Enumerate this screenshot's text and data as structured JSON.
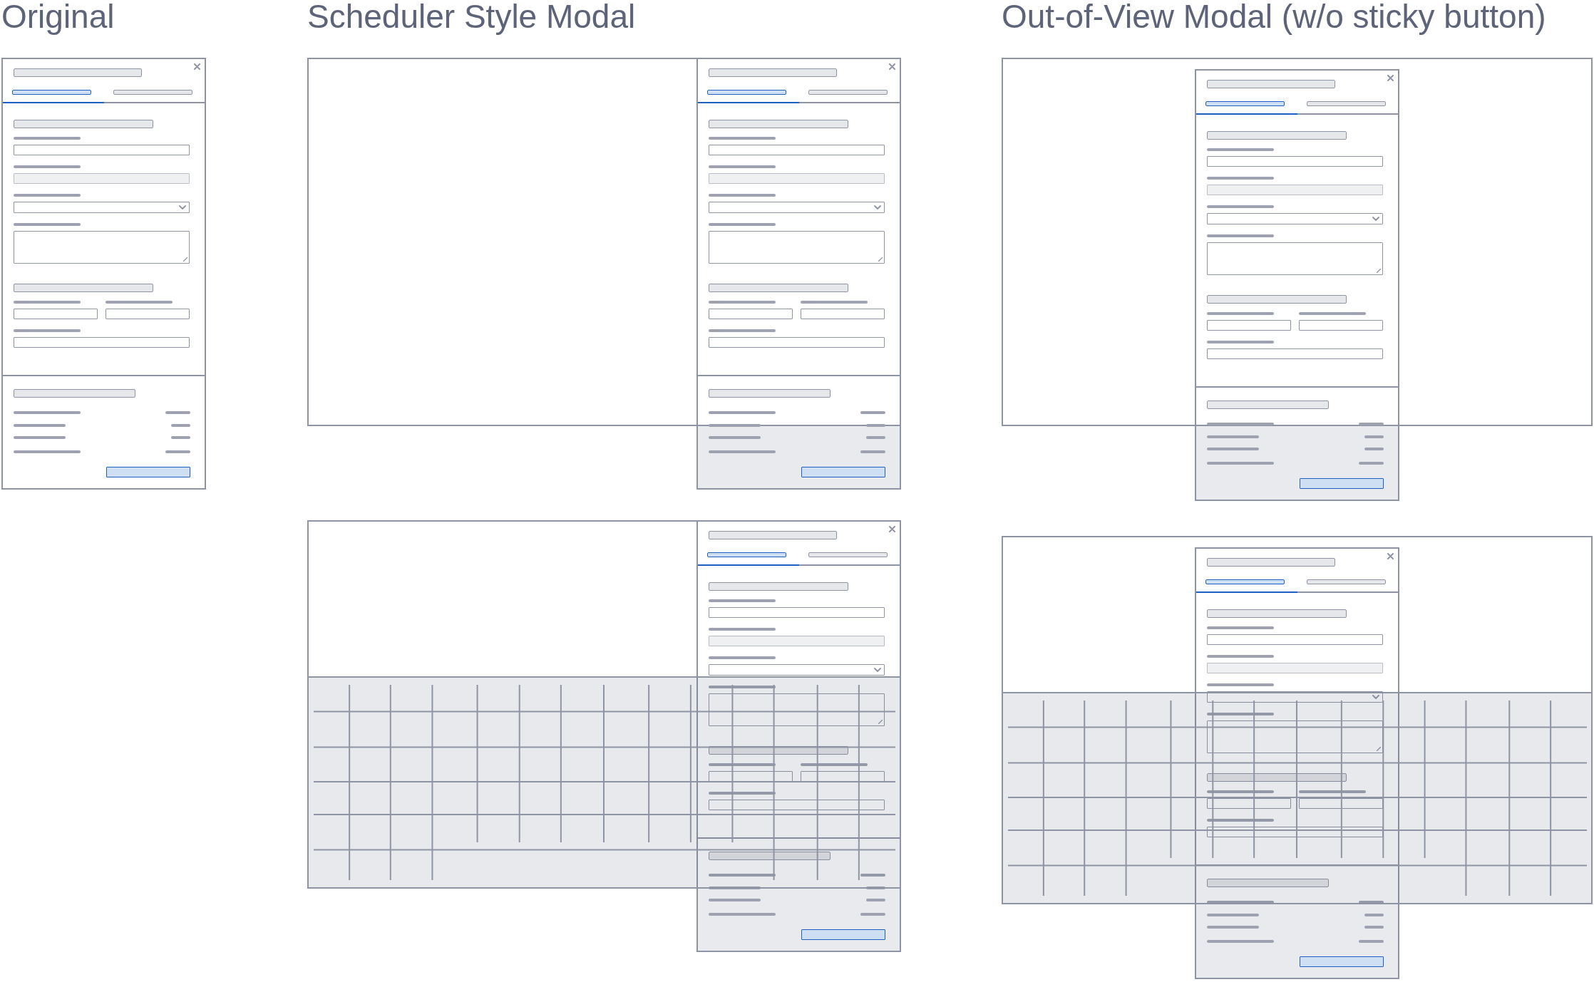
{
  "sections": [
    {
      "title": "Original",
      "frames": [
        {
          "kind": "modal_only",
          "modal": {
            "tabs": [
              {
                "selected": true
              },
              {
                "selected": false
              }
            ],
            "form_sections": [
              {
                "fields": [
                  {
                    "kind": "input",
                    "disabled": false
                  },
                  {
                    "kind": "input",
                    "disabled": true
                  },
                  {
                    "kind": "select",
                    "disabled": false
                  },
                  {
                    "kind": "textarea",
                    "disabled": false
                  }
                ]
              },
              {
                "fields": [
                  {
                    "kind": "half_input",
                    "disabled": false
                  },
                  {
                    "kind": "half_input",
                    "disabled": false
                  },
                  {
                    "kind": "input",
                    "disabled": false
                  }
                ]
              }
            ]
          }
        }
      ]
    },
    {
      "title": "Scheduler Style Modal",
      "frames": [
        {
          "kind": "docked_right",
          "grid_overlay": false,
          "modal": {
            "tabs": [
              {
                "selected": true
              },
              {
                "selected": false
              }
            ],
            "form_sections": [
              {
                "fields": [
                  {
                    "kind": "input",
                    "disabled": false
                  },
                  {
                    "kind": "input",
                    "disabled": true
                  },
                  {
                    "kind": "select",
                    "disabled": false
                  },
                  {
                    "kind": "textarea",
                    "disabled": false
                  }
                ]
              },
              {
                "fields": [
                  {
                    "kind": "half_input",
                    "disabled": false
                  },
                  {
                    "kind": "half_input",
                    "disabled": false
                  },
                  {
                    "kind": "input",
                    "disabled": false
                  }
                ]
              }
            ]
          }
        },
        {
          "kind": "docked_right",
          "grid_overlay": true,
          "modal": {
            "tabs": [
              {
                "selected": true
              },
              {
                "selected": false
              }
            ],
            "form_sections": [
              {
                "fields": [
                  {
                    "kind": "input",
                    "disabled": false
                  },
                  {
                    "kind": "input",
                    "disabled": true
                  },
                  {
                    "kind": "select",
                    "disabled": false
                  },
                  {
                    "kind": "textarea",
                    "disabled": false
                  }
                ]
              },
              {
                "fields": [
                  {
                    "kind": "half_input",
                    "disabled": false
                  },
                  {
                    "kind": "half_input",
                    "disabled": false
                  },
                  {
                    "kind": "input",
                    "disabled": false
                  }
                ]
              }
            ]
          }
        }
      ]
    },
    {
      "title": "Out-of-View Modal (w/o sticky button)",
      "frames": [
        {
          "kind": "centered",
          "grid_overlay": false,
          "modal": {
            "tabs": [
              {
                "selected": true
              },
              {
                "selected": false
              }
            ],
            "form_sections": [
              {
                "fields": [
                  {
                    "kind": "input",
                    "disabled": false
                  },
                  {
                    "kind": "input",
                    "disabled": true
                  },
                  {
                    "kind": "select",
                    "disabled": false
                  },
                  {
                    "kind": "textarea",
                    "disabled": false
                  }
                ]
              },
              {
                "fields": [
                  {
                    "kind": "half_input",
                    "disabled": false
                  },
                  {
                    "kind": "half_input",
                    "disabled": false
                  },
                  {
                    "kind": "input",
                    "disabled": false
                  }
                ]
              }
            ]
          }
        },
        {
          "kind": "centered",
          "grid_overlay": true,
          "modal": {
            "tabs": [
              {
                "selected": true
              },
              {
                "selected": false
              }
            ],
            "form_sections": [
              {
                "fields": [
                  {
                    "kind": "input",
                    "disabled": false
                  },
                  {
                    "kind": "input",
                    "disabled": true
                  },
                  {
                    "kind": "select",
                    "disabled": false
                  },
                  {
                    "kind": "textarea",
                    "disabled": false
                  }
                ]
              },
              {
                "fields": [
                  {
                    "kind": "half_input",
                    "disabled": false
                  },
                  {
                    "kind": "half_input",
                    "disabled": false
                  },
                  {
                    "kind": "input",
                    "disabled": false
                  }
                ]
              }
            ]
          }
        }
      ]
    }
  ]
}
